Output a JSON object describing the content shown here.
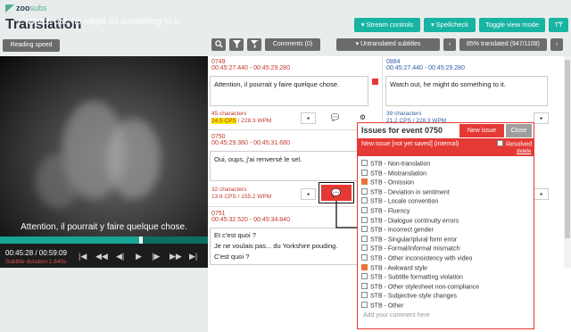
{
  "app": {
    "logo_zoo": "zoo",
    "logo_subs": "subs",
    "title": "Translation"
  },
  "toolbar": {
    "stream_controls": "▾ Stream controls",
    "spellcheck": "▾ Spellcheck",
    "toggle_view": "Toggle view mode",
    "font_icon": "T₸"
  },
  "bar2": {
    "reading_speed": "Reading speed",
    "comments": "Comments (0)",
    "filter": "▾  Untranslated subtitles",
    "prev": "‹",
    "translated": "85% translated (947/1108)",
    "next": "›"
  },
  "video": {
    "top_subtitle": "Watch out, he might do something to it.",
    "bottom_subtitle": "Attention, il pourrait y faire quelque chose.",
    "progress": 0.67,
    "timecode": "00:45:28 / 00:59:09",
    "subtitle_duration": "Subtitle duration:1.840s"
  },
  "events": [
    {
      "num": "0749",
      "time": "00:45:27.440 - 00:45:29.280",
      "text": "Attention, il pourrait y faire quelque chose.",
      "chars": "45 characters",
      "cps": "24.5 CPS",
      "wpm": " / 228.3 WPM"
    },
    {
      "num": "0750",
      "time": "00:45:29.360 - 00:45:31.680",
      "text": "Oui, oups, j'ai renversé le sel.",
      "chars": "32 characters",
      "cps": "13.8 CPS / 155.2 WPM"
    },
    {
      "num": "0751",
      "time": "00:45:32.520 - 00:45:34.840",
      "line1": "Et c'est quoi ?",
      "line2": "Je ne voulais pas... du Yorkshire pouding.",
      "line3": "C'est quoi ?"
    }
  ],
  "source": {
    "num": "0884",
    "time": "00:45:27.440 - 00:45:29.280",
    "text": "Watch out, he might do something to it.",
    "chars": "39 characters",
    "cps": "21.2 CPS / 228.3 WPM"
  },
  "dialog": {
    "title": "Issues for event 0750",
    "new_issue_btn": "New issue",
    "close_btn": "Close",
    "new_issue_label": "New issue [not yet saved] (internal)",
    "resolved_label": "Resolved",
    "delete_label": "delete",
    "comment_placeholder": "Add your comment here",
    "issues": [
      {
        "label": "STB - Non-translation",
        "checked": false
      },
      {
        "label": "STB - Mistranslation",
        "checked": false
      },
      {
        "label": "STB - Omission",
        "checked": true
      },
      {
        "label": "STB - Deviation in sentiment",
        "checked": false
      },
      {
        "label": "STB - Locale convention",
        "checked": false
      },
      {
        "label": "STB - Fluency",
        "checked": false
      },
      {
        "label": "STB - Dialogue continuity errors",
        "checked": false
      },
      {
        "label": "STB - Incorrect gender",
        "checked": false
      },
      {
        "label": "STB - Singular/plural form error",
        "checked": false
      },
      {
        "label": "STB - Formal/informal mismatch",
        "checked": false
      },
      {
        "label": "STB - Other inconsistency with video",
        "checked": false
      },
      {
        "label": "STB - Awkward style",
        "checked": true
      },
      {
        "label": "STB - Subtitle formatting violation",
        "checked": false
      },
      {
        "label": "STB - Other stylesheet non-compliance",
        "checked": false
      },
      {
        "label": "STB - Subjective style changes",
        "checked": false
      },
      {
        "label": "STB - Other",
        "checked": false
      }
    ]
  },
  "colors": {
    "accent": "#18b4a2",
    "danger": "#e53935",
    "timeline": "#17a596"
  }
}
